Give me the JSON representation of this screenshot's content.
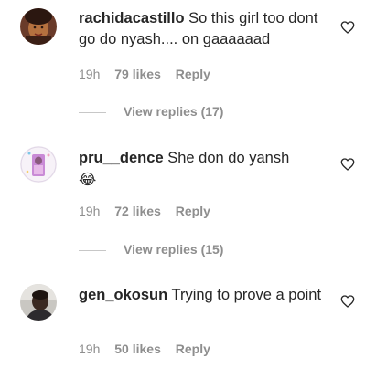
{
  "comments": [
    {
      "username": "rachidacastillo",
      "text": "So this girl too dont go do nyash.... on gaaaaaad",
      "time": "19h",
      "likes": "79 likes",
      "reply_label": "Reply",
      "view_replies": "View replies (17)",
      "avatar_icon": "avatar-photo"
    },
    {
      "username": "pru__dence",
      "text": "She don do yansh",
      "emoji": "😂",
      "time": "19h",
      "likes": "72 likes",
      "reply_label": "Reply",
      "view_replies": "View replies (15)",
      "avatar_icon": "avatar-photo"
    },
    {
      "username": "gen_okosun",
      "text": "Trying to prove a point",
      "time": "19h",
      "likes": "50 likes",
      "reply_label": "Reply",
      "avatar_icon": "avatar-photo"
    }
  ],
  "icons": {
    "like": "heart-outline-icon"
  },
  "colors": {
    "text": "#262626",
    "secondary": "#8e8e8e",
    "divider": "#c7c7c7"
  }
}
